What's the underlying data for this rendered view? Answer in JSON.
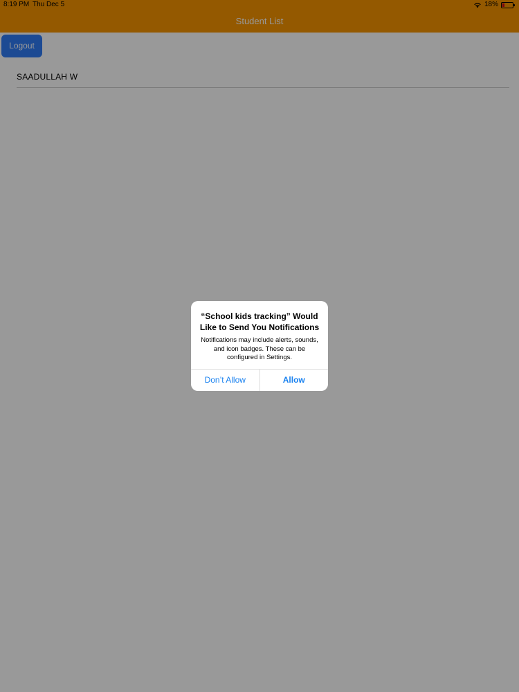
{
  "status_bar": {
    "time": "8:19 PM",
    "date": "Thu Dec 5",
    "battery": "18%",
    "battery_level": 0.18
  },
  "nav": {
    "title": "Student List"
  },
  "toolbar": {
    "logout_label": "Logout"
  },
  "students": [
    {
      "name": "SAADULLAH W"
    }
  ],
  "alert": {
    "title": "“School kids tracking” Would Like to Send You Notifications",
    "message": "Notifications may include alerts, sounds, and icon badges. These can be configured in Settings.",
    "deny_label": "Don’t Allow",
    "allow_label": "Allow"
  },
  "colors": {
    "nav_bar": "#f79500",
    "logout_button": "#2f7cf6",
    "alert_button_text": "#1a82f0",
    "overlay": "rgba(0,0,0,0.40)"
  }
}
